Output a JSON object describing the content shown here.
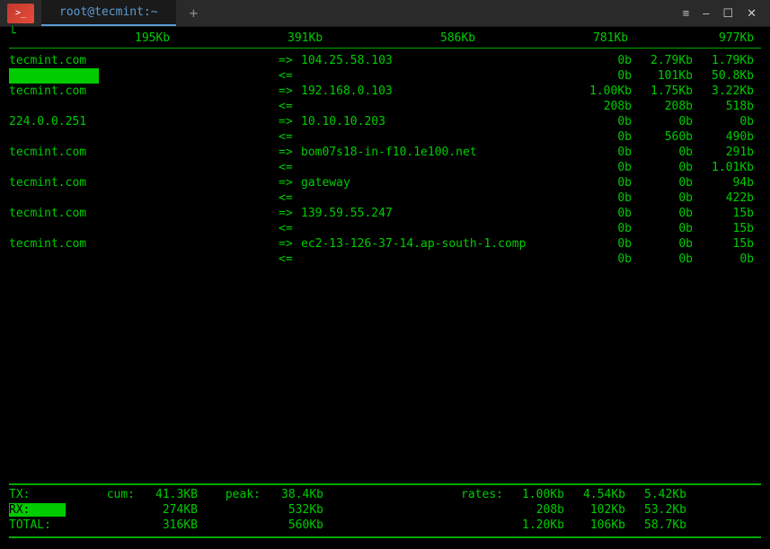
{
  "window": {
    "title": "root@tecmint:~",
    "new_tab": "+",
    "menu": "≡",
    "minimize": "–",
    "maximize": "☐",
    "close": "✕"
  },
  "scale": {
    "ticks": [
      "195Kb",
      "391Kb",
      "586Kb",
      "781Kb",
      "977Kb"
    ]
  },
  "connections": [
    {
      "local": "tecmint.com",
      "arrow_out": "=>",
      "arrow_in": "<=",
      "remote": "104.25.58.103",
      "out": [
        "0b",
        "2.79Kb",
        "1.79Kb"
      ],
      "in": [
        "0b",
        "101Kb",
        "50.8Kb"
      ],
      "highlight_local": false,
      "highlight_in": true
    },
    {
      "local": "tecmint.com",
      "arrow_out": "=>",
      "arrow_in": "<=",
      "remote": "192.168.0.103",
      "out": [
        "1.00Kb",
        "1.75Kb",
        "3.22Kb"
      ],
      "in": [
        "208b",
        "208b",
        "518b"
      ],
      "highlight_local": false,
      "highlight_in": false
    },
    {
      "local": "224.0.0.251",
      "arrow_out": "=>",
      "arrow_in": "<=",
      "remote": "10.10.10.203",
      "out": [
        "0b",
        "0b",
        "0b"
      ],
      "in": [
        "0b",
        "560b",
        "490b"
      ],
      "highlight_local": false,
      "highlight_in": false
    },
    {
      "local": "tecmint.com",
      "arrow_out": "=>",
      "arrow_in": "<=",
      "remote": "bom07s18-in-f10.1e100.net",
      "out": [
        "0b",
        "0b",
        "291b"
      ],
      "in": [
        "0b",
        "0b",
        "1.01Kb"
      ],
      "highlight_local": false,
      "highlight_in": false
    },
    {
      "local": "tecmint.com",
      "arrow_out": "=>",
      "arrow_in": "<=",
      "remote": "gateway",
      "out": [
        "0b",
        "0b",
        "94b"
      ],
      "in": [
        "0b",
        "0b",
        "422b"
      ],
      "highlight_local": false,
      "highlight_in": false
    },
    {
      "local": "tecmint.com",
      "arrow_out": "=>",
      "arrow_in": "<=",
      "remote": "139.59.55.247",
      "out": [
        "0b",
        "0b",
        "15b"
      ],
      "in": [
        "0b",
        "0b",
        "15b"
      ],
      "highlight_local": false,
      "highlight_in": false
    },
    {
      "local": "tecmint.com",
      "arrow_out": "=>",
      "arrow_in": "<=",
      "remote": "ec2-13-126-37-14.ap-south-1.comp",
      "out": [
        "0b",
        "0b",
        "15b"
      ],
      "in": [
        "0b",
        "0b",
        "0b"
      ],
      "highlight_local": false,
      "highlight_in": false
    }
  ],
  "stats": {
    "tx_label": "TX:",
    "rx_label": "RX:",
    "total_label": "TOTAL:",
    "cum_label": "cum:",
    "peak_label": "peak:",
    "rates_label": "rates:",
    "tx": {
      "cum": "41.3KB",
      "peak": "38.4Kb",
      "rates": [
        "1.00Kb",
        "4.54Kb",
        "5.42Kb"
      ]
    },
    "rx": {
      "cum": "274KB",
      "peak": "532Kb",
      "rates": [
        "208b",
        "102Kb",
        "53.2Kb"
      ]
    },
    "total": {
      "cum": "316KB",
      "peak": "560Kb",
      "rates": [
        "1.20Kb",
        "106Kb",
        "58.7Kb"
      ]
    }
  }
}
